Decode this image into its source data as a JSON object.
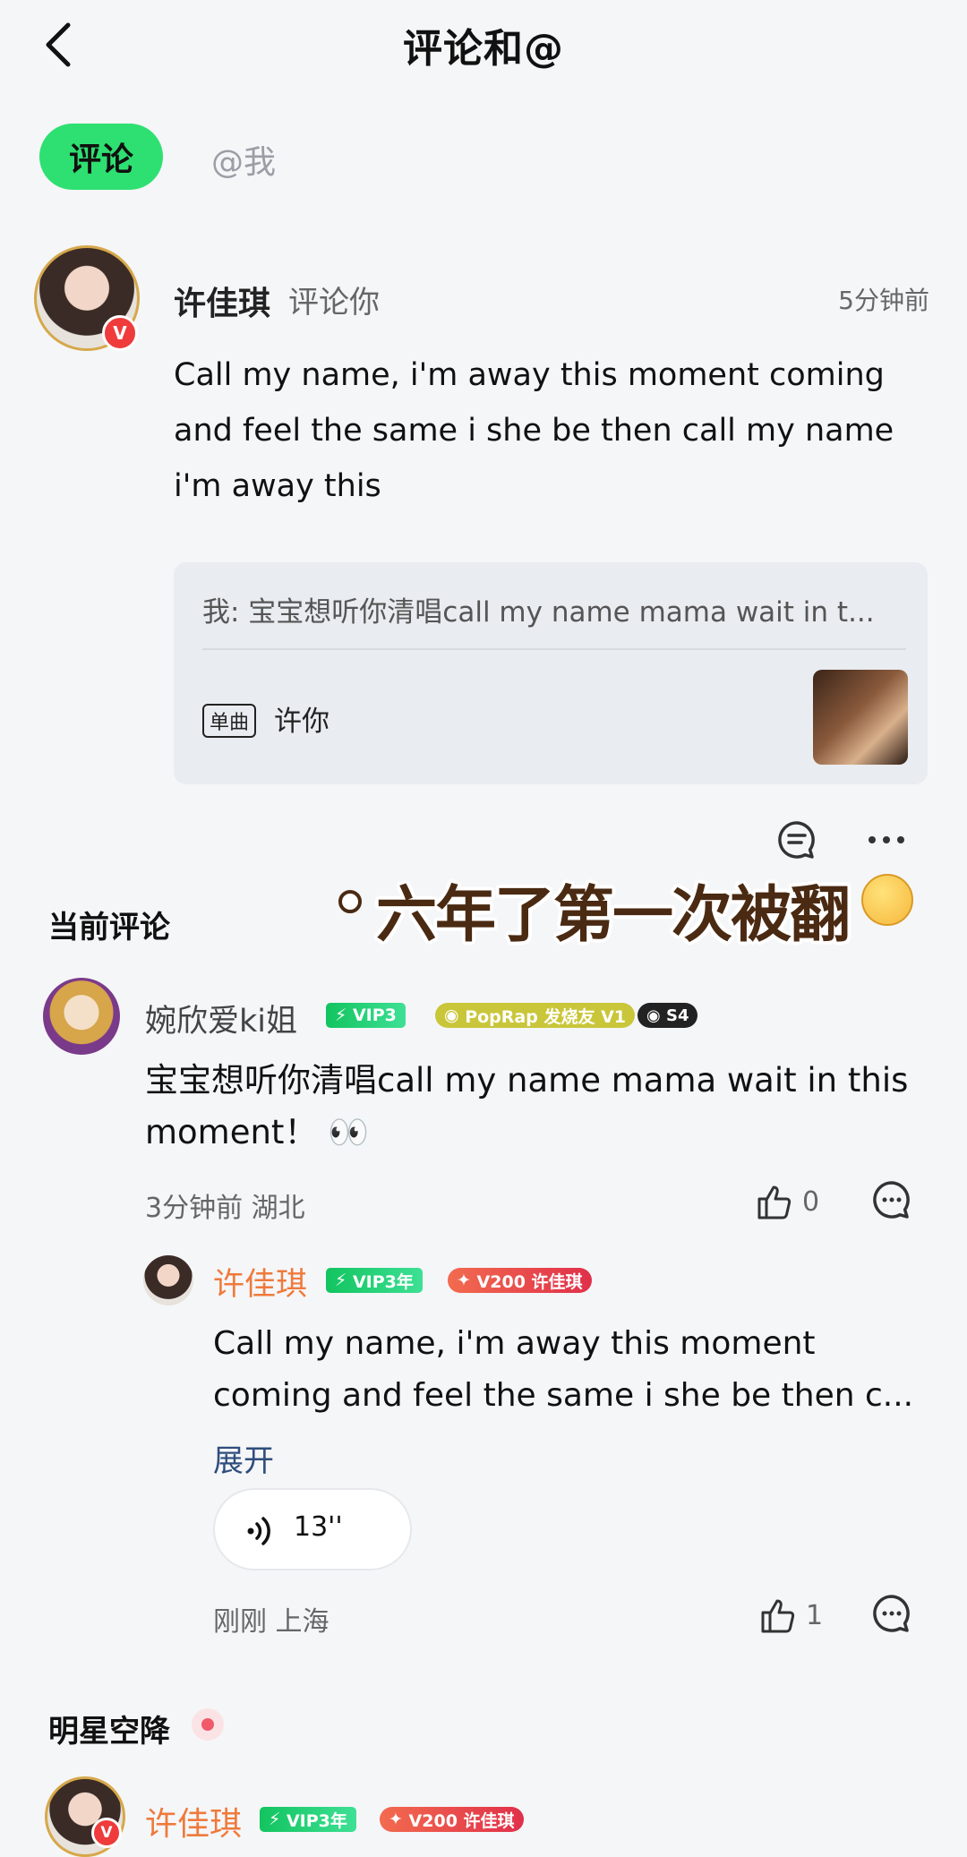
{
  "header": {
    "title": "评论和@"
  },
  "tabs": [
    {
      "label": "评论",
      "active": true
    },
    {
      "label": "@我",
      "active": false
    }
  ],
  "notification": {
    "user": "许佳琪",
    "action": "评论你",
    "time": "5分钟前",
    "text": "Call my name, i'm away this moment coming and feel the same i she be then call my name i'm away this",
    "quote": {
      "text": "我: 宝宝想听你清唱call my name mama wait in t...",
      "tag": "单曲",
      "song": "许你"
    }
  },
  "overlay_caption": "六年了第一次被翻",
  "current_comments": {
    "title": "当前评论",
    "comment": {
      "user": "婉欣爱ki姐",
      "badges": {
        "vip": "VIP3",
        "fan": "PopRap 发烧友 V1",
        "level": "S4"
      },
      "text": "宝宝想听你清唱call my name mama wait in this moment！ 👀",
      "time": "3分钟前",
      "location": "湖北",
      "likes": "0"
    },
    "reply": {
      "user": "许佳琪",
      "badges": {
        "vip": "VIP3年",
        "v200": "V200 许佳琪"
      },
      "text": "Call my name, i'm away this moment coming and feel the same i she be then c...",
      "expand": "展开",
      "voice_duration": "13''",
      "time": "刚刚",
      "location": "上海",
      "likes": "1"
    }
  },
  "star_section": {
    "title": "明星空降",
    "user": "许佳琪",
    "badges": {
      "vip": "VIP3年",
      "v200": "V200 许佳琪"
    }
  },
  "colors": {
    "accent": "#2ee071",
    "orange_name": "#ef7a3c",
    "link": "#2f4e7c"
  }
}
